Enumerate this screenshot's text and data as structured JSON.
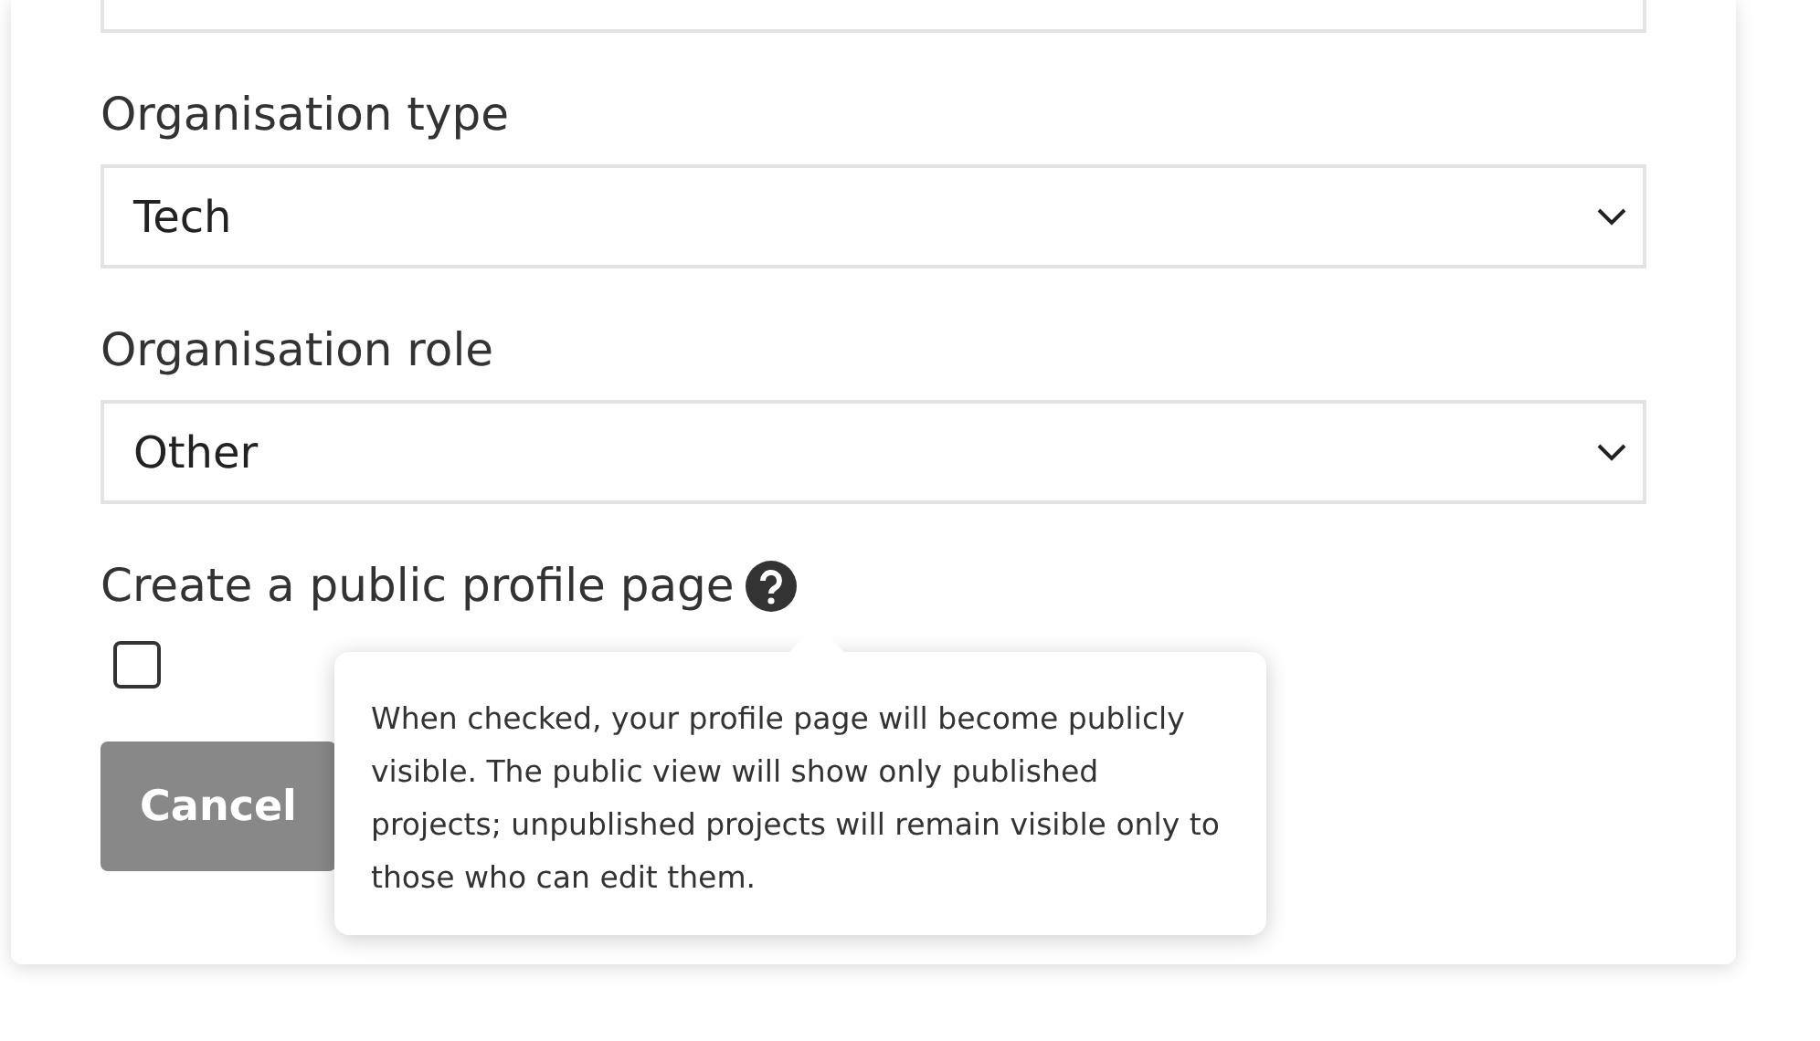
{
  "fields": [
    {
      "label": "Organisation type",
      "value": "Tech"
    },
    {
      "label": "Organisation role",
      "value": "Other"
    }
  ],
  "public_profile": {
    "label": "Create a public profile page",
    "checked": false,
    "tooltip": "When checked, your profile page will become publicly visible. The public view will show only published projects; unpublished projects will remain visible only to those who can edit them."
  },
  "buttons": [
    "Cancel"
  ]
}
